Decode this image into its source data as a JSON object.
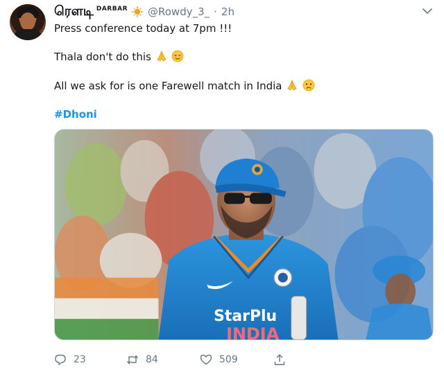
{
  "tweet": {
    "author_name": "ரௌடி",
    "author_badge": "DARBAR",
    "handle": "@Rowdy_3_",
    "separator": "·",
    "time": "2h",
    "lines": [
      "Press conference today at 7pm !!!",
      "Thala don't do this",
      "All we ask for is one Farewell match in India"
    ],
    "hashtag": "#Dhoni",
    "media": {
      "jersey_brand": "StarPlu",
      "jersey_country": "INDIA"
    },
    "icons": [
      "avatar",
      "sun-icon",
      "chevron-down-icon",
      "folded-hands-icon",
      "relieved-face-icon",
      "worried-face-icon",
      "reply-icon",
      "retweet-icon",
      "like-icon",
      "share-icon"
    ],
    "counts": {
      "replies": "23",
      "retweets": "84",
      "likes": "509"
    }
  },
  "colors": {
    "text": "#14171a",
    "muted": "#657786",
    "hashtag": "#1b95e0",
    "jersey_blue": "#1e88d6"
  }
}
